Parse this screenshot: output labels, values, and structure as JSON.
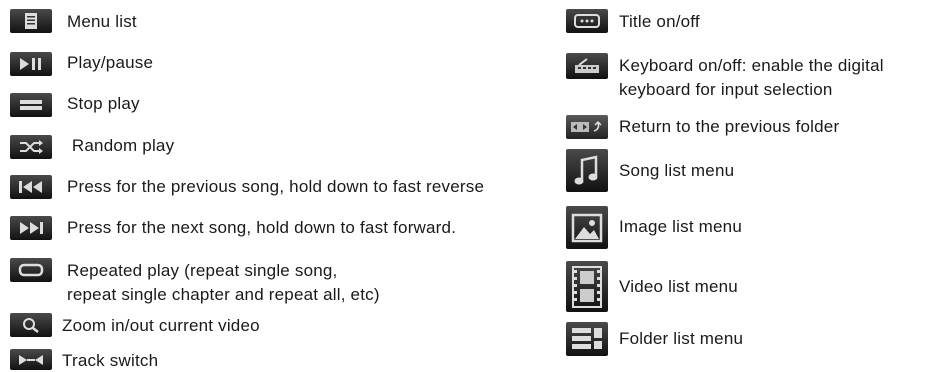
{
  "left_items": [
    {
      "icon": "menu-list-icon",
      "label": "Menu list"
    },
    {
      "icon": "play-pause-icon",
      "label": "Play/pause"
    },
    {
      "icon": "stop-icon",
      "label": "Stop play"
    },
    {
      "icon": "shuffle-icon",
      "label": " Random play"
    },
    {
      "icon": "previous-icon",
      "label": "Press for the previous song, hold down to fast reverse"
    },
    {
      "icon": "next-icon",
      "label": "Press for the next song, hold down to fast forward."
    },
    {
      "icon": "repeat-icon",
      "label": "Repeated play (repeat single song,",
      "label2": "repeat single chapter and repeat all, etc)"
    },
    {
      "icon": "zoom-icon",
      "label": "Zoom in/out current video"
    },
    {
      "icon": "track-switch-icon",
      "label": "Track switch"
    }
  ],
  "right_items": [
    {
      "icon": "title-icon",
      "label": "Title on/off"
    },
    {
      "icon": "keyboard-icon",
      "label": "Keyboard on/off: enable the digital",
      "label2": "keyboard for input selection"
    },
    {
      "icon": "return-folder-icon",
      "label": "Return to the previous folder"
    },
    {
      "icon": "music-note-icon",
      "label": "Song list menu"
    },
    {
      "icon": "image-icon",
      "label": "Image list menu"
    },
    {
      "icon": "film-icon",
      "label": "Video list menu"
    },
    {
      "icon": "folder-list-icon",
      "label": "Folder list menu"
    }
  ]
}
